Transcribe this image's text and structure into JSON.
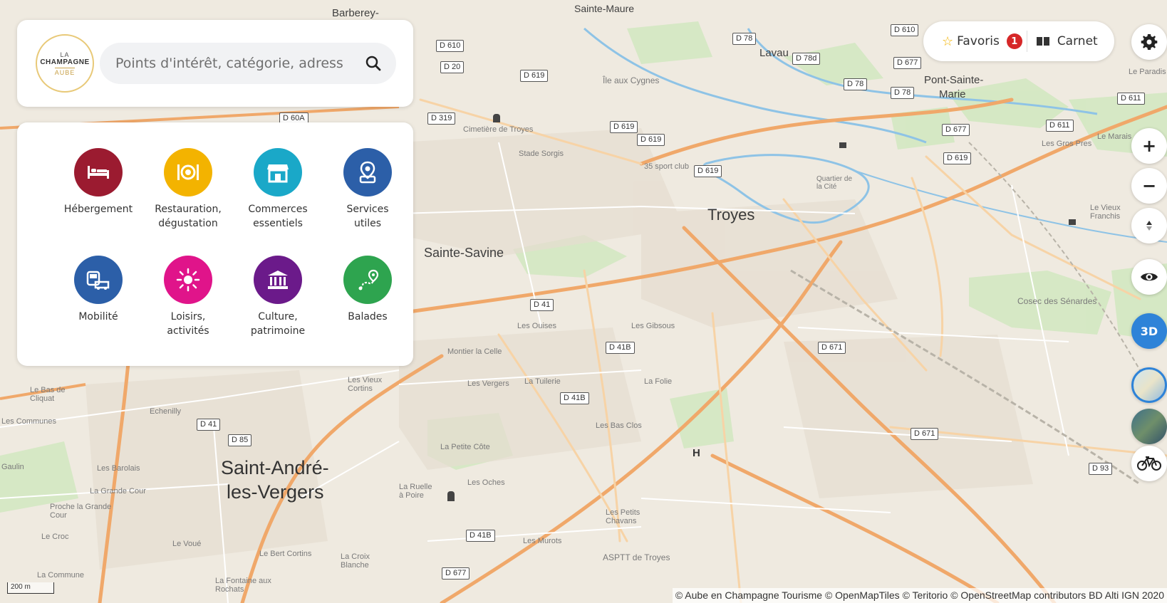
{
  "search": {
    "placeholder": "Points d'intérêt, catégorie, adresse"
  },
  "logo": {
    "line1": "LA",
    "line2": "CHAMPAGNE",
    "line3": "AUBE"
  },
  "categories": [
    {
      "label": "Hébergement",
      "color": "#9b1b30",
      "icon": "bed-icon"
    },
    {
      "label": "Restauration,\ndégustation",
      "color": "#f3b300",
      "icon": "plate-icon"
    },
    {
      "label": "Commerces\nessentiels",
      "color": "#1aa8c8",
      "icon": "shop-icon"
    },
    {
      "label": "Services\nutiles",
      "color": "#2c5fa8",
      "icon": "map-pin-icon"
    },
    {
      "label": "Mobilité",
      "color": "#2c5fa8",
      "icon": "car-bus-icon"
    },
    {
      "label": "Loisirs,\nactivités",
      "color": "#e0148a",
      "icon": "sun-icon"
    },
    {
      "label": "Culture,\npatrimoine",
      "color": "#6b1a8a",
      "icon": "monument-icon"
    },
    {
      "label": "Balades",
      "color": "#2ea44f",
      "icon": "route-icon"
    }
  ],
  "topbar": {
    "favoris_label": "Favoris",
    "favoris_count": "1",
    "carnet_label": "Carnet"
  },
  "controls": {
    "three_d_label": "3D"
  },
  "scale": "200 m",
  "attribution": "© Aube en Champagne Tourisme © OpenMapTiles © Teritorio © OpenStreetMap contributors BD Alti IGN 2020",
  "map_labels": [
    {
      "text": "Troyes",
      "cls": "city"
    },
    {
      "text": "Sainte-Savine",
      "cls": "town"
    },
    {
      "text": "Saint-André-",
      "cls": "big"
    },
    {
      "text": "les-Vergers",
      "cls": "big"
    },
    {
      "text": "Pont-Sainte-",
      "cls": "town"
    },
    {
      "text": "Marie",
      "cls": "town"
    },
    {
      "text": "Barberey-",
      "cls": "town"
    },
    {
      "text": "Sainte-Maure",
      "cls": "town"
    },
    {
      "text": "Lavau",
      "cls": "town"
    },
    {
      "text": "Le Paradis",
      "cls": "small"
    },
    {
      "text": "Cosec des Sénardes",
      "cls": "small"
    },
    {
      "text": "Les Gibsous",
      "cls": "small"
    },
    {
      "text": "Les Ouises",
      "cls": "small"
    },
    {
      "text": "Montier la Celle",
      "cls": "small"
    },
    {
      "text": "Les Vergers",
      "cls": "small"
    },
    {
      "text": "La Tuilerie",
      "cls": "small"
    },
    {
      "text": "La Folie",
      "cls": "small"
    },
    {
      "text": "Les Bas Clos",
      "cls": "small"
    },
    {
      "text": "La Petite Côte",
      "cls": "small"
    },
    {
      "text": "Les Oches",
      "cls": "small"
    },
    {
      "text": "Les Murots",
      "cls": "small"
    },
    {
      "text": "ASPTT de Troyes",
      "cls": "small"
    },
    {
      "text": "Les Petits Chavans",
      "cls": "small"
    },
    {
      "text": "La Croix Blanche",
      "cls": "small"
    },
    {
      "text": "Le Bert Cortins",
      "cls": "small"
    },
    {
      "text": "Le Voué",
      "cls": "small"
    },
    {
      "text": "La Fontaine aux Rochats",
      "cls": "small"
    },
    {
      "text": "La Commune",
      "cls": "small"
    },
    {
      "text": "Le Croc",
      "cls": "small"
    },
    {
      "text": "Proche la Grande Cour",
      "cls": "small"
    },
    {
      "text": "La Grande Cour",
      "cls": "small"
    },
    {
      "text": "Les Barolais",
      "cls": "small"
    },
    {
      "text": "Gaulin",
      "cls": "small"
    },
    {
      "text": "Les Communes",
      "cls": "small"
    },
    {
      "text": "Echenilly",
      "cls": "small"
    },
    {
      "text": "Le Bas de Cliquat",
      "cls": "small"
    },
    {
      "text": "Cimetière de Troyes",
      "cls": "small"
    },
    {
      "text": "Stade Sorgis",
      "cls": "small"
    },
    {
      "text": "35 sport club",
      "cls": "small"
    },
    {
      "text": "Quartier de la Cité",
      "cls": "small"
    },
    {
      "text": "Île aux Cygnes",
      "cls": "small"
    },
    {
      "text": "Les Gros Pres",
      "cls": "small"
    },
    {
      "text": "Le Marais",
      "cls": "small"
    },
    {
      "text": "Le Vieux Franchis",
      "cls": "small"
    },
    {
      "text": "La Ruelle à Poire",
      "cls": "small"
    },
    {
      "text": "Les Vieux Cortins",
      "cls": "small"
    }
  ],
  "road_shields": [
    "D 41",
    "D 41B",
    "D 41B",
    "D 671",
    "D 671",
    "D 41",
    "D 85",
    "D 41B",
    "D 677",
    "D 93",
    "D 619",
    "D 619",
    "D 619",
    "D 619",
    "D 611",
    "D 611",
    "D 677",
    "D 319",
    "D 60A",
    "D 619",
    "D 20",
    "D 78",
    "D 78",
    "D 78",
    "D 78d",
    "D 677",
    "D 610",
    "D 610"
  ]
}
